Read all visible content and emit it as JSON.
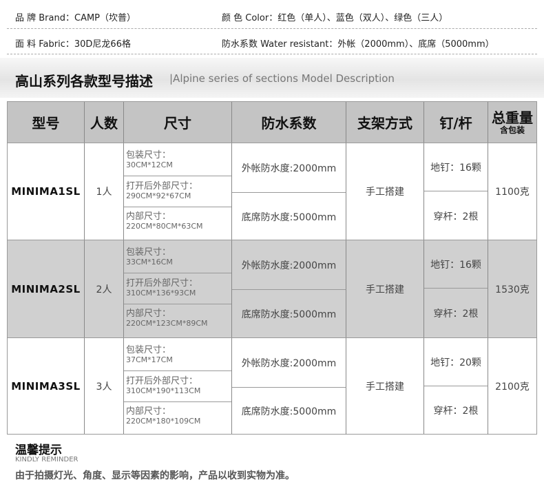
{
  "specs": {
    "brand": "品 牌 Brand：CAMP（坎普）",
    "color": "颜 色 Color：红色（单人）、蓝色（双人）、绿色（三人）",
    "fabric": "面 料 Fabric：30D尼龙66格",
    "water": "防水系数 Water resistant：外帐（2000mm）、底席（5000mm）"
  },
  "section": {
    "title_cn": "高山系列各款型号描述",
    "title_en": "|Alpine series of sections Model Description"
  },
  "table": {
    "headers": {
      "model": "型号",
      "people": "人数",
      "size": "尺寸",
      "waterproof": "防水系数",
      "support": "支架方式",
      "nails": "钉/杆",
      "weight": "总重量",
      "weight_sub": "含包装"
    },
    "rows": [
      {
        "model": "MINIMA1SL",
        "people": "1人",
        "pack_label": "包装尺寸：",
        "pack_val": "30CM*12CM",
        "open_label": "打开后外部尺寸：",
        "open_val": "290CM*92*67CM",
        "inner_label": "内部尺寸：",
        "inner_val": "220CM*80CM*63CM",
        "outer_water": "外帐防水度:2000mm",
        "floor_water": "底席防水度:5000mm",
        "support": "手工搭建",
        "nails": "地钉：16颗",
        "poles": "穿杆：2根",
        "weight": "1100克"
      },
      {
        "model": "MINIMA2SL",
        "people": "2人",
        "pack_label": "包装尺寸：",
        "pack_val": "33CM*16CM",
        "open_label": "打开后外部尺寸：",
        "open_val": "310CM*136*93CM",
        "inner_label": "内部尺寸：",
        "inner_val": "220CM*123CM*89CM",
        "outer_water": "外帐防水度:2000mm",
        "floor_water": "底席防水度:5000mm",
        "support": "手工搭建",
        "nails": "地钉：16颗",
        "poles": "穿杆：2根",
        "weight": "1530克"
      },
      {
        "model": "MINIMA3SL",
        "people": "3人",
        "pack_label": "包装尺寸：",
        "pack_val": "37CM*17CM",
        "open_label": "打开后外部尺寸：",
        "open_val": "310CM*190*113CM",
        "inner_label": "内部尺寸：",
        "inner_val": "220CM*180*109CM",
        "outer_water": "外帐防水度:2000mm",
        "floor_water": "底席防水度:5000mm",
        "support": "手工搭建",
        "nails": "地钉：20颗",
        "poles": "穿杆：2根",
        "weight": "2100克"
      }
    ]
  },
  "reminder": {
    "title_cn": "温馨提示",
    "title_en": "KINDLY REMINDER",
    "text": "由于拍摄灯光、角度、显示等因素的影响，产品以收到实物为准。"
  }
}
